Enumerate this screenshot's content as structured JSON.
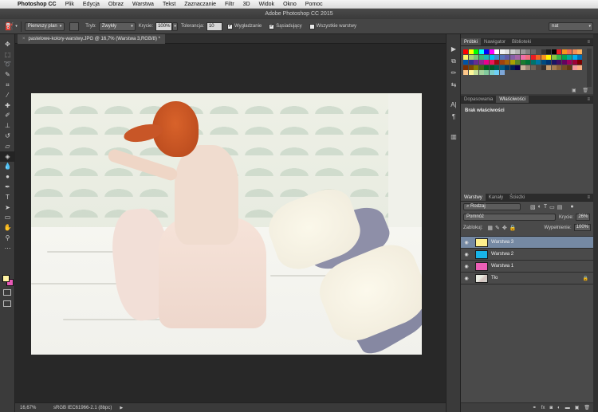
{
  "menubar": {
    "app_name": "Photoshop CC",
    "items": [
      "Plik",
      "Edycja",
      "Obraz",
      "Warstwa",
      "Tekst",
      "Zaznaczanie",
      "Filtr",
      "3D",
      "Widok",
      "Okno",
      "Pomoc"
    ]
  },
  "window": {
    "title": "Adobe Photoshop CC 2015"
  },
  "options": {
    "fill_source": "Pierwszy plan",
    "mode_label": "Tryb:",
    "mode_value": "Zwykły",
    "opacity_label": "Krycie:",
    "opacity_value": "100%",
    "tolerance_label": "Tolerancja:",
    "tolerance_value": "10",
    "antialias_label": "Wygładzanie",
    "antialias_checked": true,
    "contiguous_label": "Sąsiadujący",
    "contiguous_checked": true,
    "all_layers_label": "Wszystkie warstwy",
    "all_layers_checked": false,
    "workspace": "nat"
  },
  "document": {
    "tab_title": "pastelowe-kolory-warstwy.JPG @ 16,7% (Warstwa 3,RGB/8) *",
    "close_glyph": "×"
  },
  "status": {
    "zoom": "16,67%",
    "profile": "sRGB IEC61966-2.1 (8bpc)",
    "arrow": "▶"
  },
  "swatches_panel": {
    "tabs": [
      "Próbki",
      "Nawigator",
      "Biblioteki"
    ],
    "colors": [
      "#ff0000",
      "#ffff00",
      "#00ff00",
      "#00ffff",
      "#0000ff",
      "#ff00ff",
      "#ffffff",
      "#f2f2f2",
      "#e0e0e0",
      "#cccccc",
      "#b3b3b3",
      "#999999",
      "#808080",
      "#666666",
      "#4d4d4d",
      "#333333",
      "#1a1a1a",
      "#000000",
      "#ee1d24",
      "#f7941d",
      "#f26c4f",
      "#f68e56",
      "#fbaf5c",
      "#fff467",
      "#acd372",
      "#7cc576",
      "#3bb878",
      "#1abbb4",
      "#00bff3",
      "#438ccb",
      "#5574b9",
      "#605ca8",
      "#855fa8",
      "#a763a8",
      "#f06ea9",
      "#f26d7d",
      "#ed1c24",
      "#f26522",
      "#f7941d",
      "#fff200",
      "#8dc63f",
      "#39b54a",
      "#00a651",
      "#00a99d",
      "#00aeef",
      "#0072bc",
      "#0054a6",
      "#2e3192",
      "#662d91",
      "#92278f",
      "#ec008c",
      "#ed145b",
      "#9e0b0f",
      "#a0410d",
      "#a36209",
      "#aba000",
      "#598527",
      "#1a7b30",
      "#007236",
      "#00746b",
      "#0076a3",
      "#004b80",
      "#003471",
      "#1b1464",
      "#440e62",
      "#630460",
      "#9e005d",
      "#9e0039",
      "#790000",
      "#7b2e00",
      "#7d4900",
      "#827b00",
      "#406618",
      "#005e20",
      "#005826",
      "#005952",
      "#005b7f",
      "#003663",
      "#002157",
      "#0d004c",
      "#c7b299",
      "#998675",
      "#736357",
      "#534741",
      "#37302d",
      "#c69c6d",
      "#a67c52",
      "#8c6239",
      "#754c24",
      "#603913",
      "#f5989d",
      "#f9ad81",
      "#fdc68a",
      "#fff799",
      "#c4df9b",
      "#a3d39c",
      "#82ca9d",
      "#7bcdc8",
      "#6ecff6",
      "#7ea7d8"
    ],
    "footer_icons": [
      "new-swatch-icon",
      "trash-icon"
    ]
  },
  "properties_panel": {
    "tabs": [
      "Dopasowania",
      "Właściwości"
    ],
    "message": "Brak właściwości"
  },
  "layers_panel": {
    "tabs": [
      "Warstwy",
      "Kanały",
      "Ścieżki"
    ],
    "filter_value": "Rodzaj",
    "blend_mode": "Pomnóż",
    "opacity_label": "Krycie:",
    "opacity_value": "26%",
    "lock_label": "Zablokuj:",
    "fill_label": "Wypełnienie:",
    "fill_value": "100%",
    "layers": [
      {
        "name": "Warstwa 3",
        "color": "#fff08c",
        "selected": true,
        "locked": false
      },
      {
        "name": "Warstwa 2",
        "color": "#18b4e8",
        "selected": false,
        "locked": false
      },
      {
        "name": "Warstwa 1",
        "color": "#ec5fb6",
        "selected": false,
        "locked": false
      },
      {
        "name": "Tło",
        "color": "#cfd4cf",
        "selected": false,
        "locked": true
      }
    ],
    "footer": [
      "link-icon",
      "fx-icon",
      "mask-icon",
      "adjustment-icon",
      "folder-icon",
      "new-layer-icon",
      "trash-icon"
    ]
  },
  "colors": {
    "foreground": "#fff3a4",
    "background": "#e75ab6",
    "selected_layer": "#7589a3"
  }
}
